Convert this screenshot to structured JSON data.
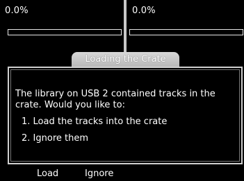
{
  "decks": [
    {
      "percent_label": "0.0%",
      "progress": 0.0
    },
    {
      "percent_label": "0.0%",
      "progress": 0.0
    }
  ],
  "dialog": {
    "title": "Loading the Crate",
    "message": "The library on USB 2 contained tracks in the crate. Would you like to:",
    "options": [
      "1. Load the tracks into the crate",
      "2. Ignore them"
    ]
  },
  "softkeys": {
    "load": "Load",
    "ignore": "Ignore"
  },
  "colors": {
    "background": "#000000",
    "text": "#ffffff",
    "frame": "#d0d0d0"
  }
}
